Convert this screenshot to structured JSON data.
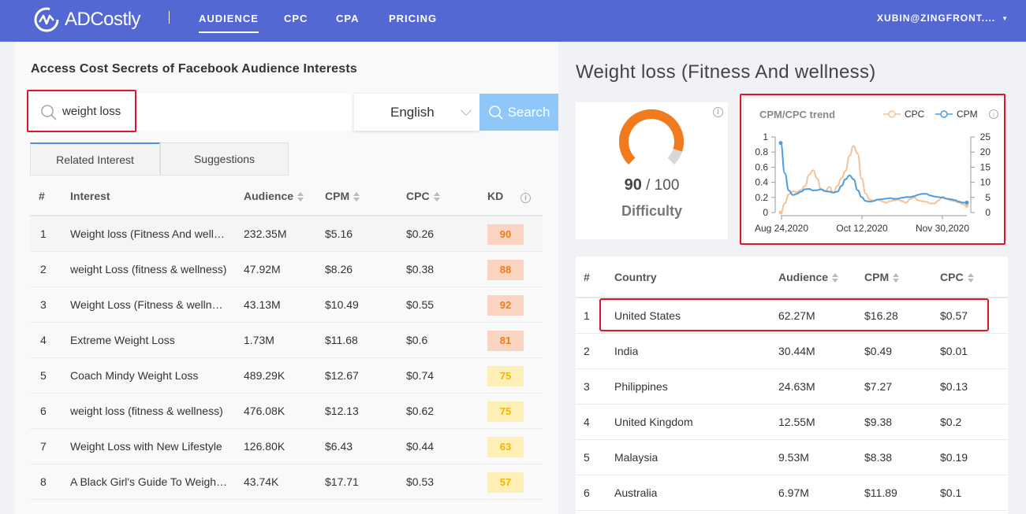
{
  "app": {
    "name": "ADCostly"
  },
  "nav": {
    "items": [
      "AUDIENCE",
      "CPC",
      "CPA",
      "PRICING"
    ],
    "user": "XUBIN@ZINGFRONT...."
  },
  "left": {
    "title": "Access Cost Secrets of Facebook Audience Interests",
    "search_value": "weight loss",
    "language": "English",
    "search_button": "Search",
    "tabs": [
      "Related Interest",
      "Suggestions"
    ],
    "columns": [
      "#",
      "Interest",
      "Audience",
      "CPM",
      "CPC",
      "KD"
    ],
    "rows": [
      {
        "n": "1",
        "interest": "Weight loss (Fitness And wellness)",
        "audience": "232.35M",
        "cpm": "$5.16",
        "cpc": "$0.26",
        "kd": "90",
        "kd_bg": "#fad4c0",
        "kd_fg": "#f07b1e"
      },
      {
        "n": "2",
        "interest": "weight Loss (fitness & wellness)",
        "audience": "47.92M",
        "cpm": "$8.26",
        "cpc": "$0.38",
        "kd": "88",
        "kd_bg": "#fad4c0",
        "kd_fg": "#f07b1e"
      },
      {
        "n": "3",
        "interest": "Weight Loss (Fitness & wellness)",
        "audience": "43.13M",
        "cpm": "$10.49",
        "cpc": "$0.55",
        "kd": "92",
        "kd_bg": "#fad4c0",
        "kd_fg": "#f07b1e"
      },
      {
        "n": "4",
        "interest": "Extreme Weight Loss",
        "audience": "1.73M",
        "cpm": "$11.68",
        "cpc": "$0.6",
        "kd": "81",
        "kd_bg": "#fad4c0",
        "kd_fg": "#f07b1e"
      },
      {
        "n": "5",
        "interest": "Coach Mindy Weight Loss",
        "audience": "489.29K",
        "cpm": "$12.67",
        "cpc": "$0.74",
        "kd": "75",
        "kd_bg": "#fdefb5",
        "kd_fg": "#f5b400"
      },
      {
        "n": "6",
        "interest": "weight loss (fitness & wellness)",
        "audience": "476.08K",
        "cpm": "$12.13",
        "cpc": "$0.62",
        "kd": "75",
        "kd_bg": "#fdefb5",
        "kd_fg": "#f5b400"
      },
      {
        "n": "7",
        "interest": "Weight Loss with New Lifestyle",
        "audience": "126.80K",
        "cpm": "$6.43",
        "cpc": "$0.44",
        "kd": "63",
        "kd_bg": "#fdefb5",
        "kd_fg": "#f5b400"
      },
      {
        "n": "8",
        "interest": "A Black Girl's Guide To Weight Loss",
        "audience": "43.74K",
        "cpm": "$17.71",
        "cpc": "$0.53",
        "kd": "57",
        "kd_bg": "#fdefb5",
        "kd_fg": "#f5b400"
      }
    ]
  },
  "right": {
    "title": "Weight loss (Fitness And wellness)",
    "difficulty": {
      "value": 90,
      "max": "/ 100",
      "label": "Difficulty",
      "color": "#f07b1e"
    },
    "trend_title": "CPM/CPC trend",
    "columns": [
      "#",
      "Country",
      "Audience",
      "CPM",
      "CPC"
    ],
    "countries": [
      {
        "n": "1",
        "country": "United States",
        "audience": "62.27M",
        "cpm": "$16.28",
        "cpc": "$0.57"
      },
      {
        "n": "2",
        "country": "India",
        "audience": "30.44M",
        "cpm": "$0.49",
        "cpc": "$0.01"
      },
      {
        "n": "3",
        "country": "Philippines",
        "audience": "24.63M",
        "cpm": "$7.27",
        "cpc": "$0.13"
      },
      {
        "n": "4",
        "country": "United Kingdom",
        "audience": "12.55M",
        "cpm": "$9.38",
        "cpc": "$0.2"
      },
      {
        "n": "5",
        "country": "Malaysia",
        "audience": "9.53M",
        "cpm": "$8.38",
        "cpc": "$0.19"
      },
      {
        "n": "6",
        "country": "Australia",
        "audience": "6.97M",
        "cpm": "$11.89",
        "cpc": "$0.1"
      }
    ]
  },
  "chart_data": {
    "type": "line",
    "title": "CPM/CPC trend",
    "x_ticks": [
      "Aug 24,2020",
      "Oct 12,2020",
      "Nov 30,2020"
    ],
    "y_left_ticks": [
      "1",
      "0.8",
      "0.6",
      "0.4",
      "0.2",
      "0"
    ],
    "y_right_ticks": [
      "25",
      "20",
      "15",
      "10",
      "5",
      "0"
    ],
    "ylim_left": [
      0,
      1
    ],
    "ylim_right": [
      0,
      25
    ],
    "series": [
      {
        "name": "CPC",
        "axis": "left",
        "color": "#f4c29a",
        "values": [
          0.0,
          0.12,
          0.24,
          0.28,
          0.27,
          0.3,
          0.35,
          0.5,
          0.56,
          0.45,
          0.3,
          0.28,
          0.34,
          0.26,
          0.35,
          0.45,
          0.55,
          0.75,
          0.88,
          0.78,
          0.45,
          0.25,
          0.17,
          0.16,
          0.17,
          0.15,
          0.13,
          0.15,
          0.16,
          0.17,
          0.15,
          0.13,
          0.18,
          0.2,
          0.16,
          0.15,
          0.14,
          0.12,
          0.12,
          0.16,
          0.21,
          0.18,
          0.16,
          0.15,
          0.13,
          0.11,
          0.09
        ]
      },
      {
        "name": "CPM",
        "axis": "right",
        "color": "#4a9de0",
        "values": [
          23.0,
          13.0,
          7.3,
          5.8,
          6.2,
          6.9,
          7.7,
          7.8,
          7.3,
          7.4,
          7.7,
          7.1,
          6.9,
          6.6,
          6.9,
          8.8,
          11.0,
          12.3,
          11.0,
          7.4,
          5.1,
          3.8,
          3.6,
          3.8,
          4.3,
          4.4,
          4.6,
          4.8,
          4.5,
          4.6,
          4.9,
          5.1,
          5.1,
          5.4,
          5.9,
          6.2,
          6.2,
          5.6,
          5.3,
          5.1,
          4.9,
          4.6,
          4.4,
          4.1,
          3.6,
          3.3,
          3.3
        ]
      }
    ]
  }
}
